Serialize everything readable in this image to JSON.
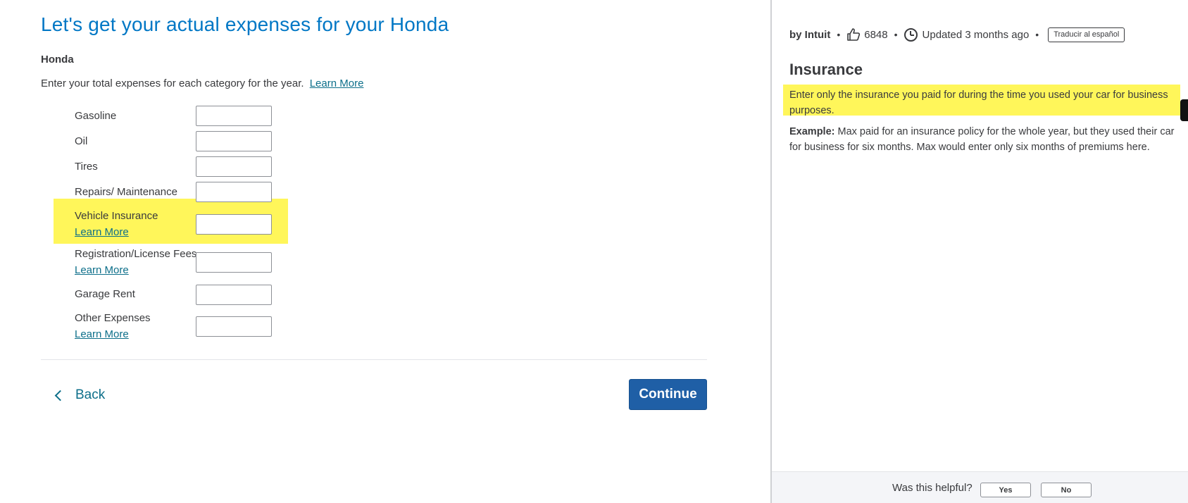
{
  "main": {
    "title": "Let's get your actual expenses for your Honda",
    "vehicle_name": "Honda",
    "intro_text": "Enter your total expenses for each category for the year.",
    "intro_link": "Learn More",
    "rows": [
      {
        "label": "Gasoline",
        "value": ""
      },
      {
        "label": "Oil",
        "value": ""
      },
      {
        "label": "Tires",
        "value": ""
      },
      {
        "label": "Repairs/ Maintenance",
        "value": ""
      },
      {
        "label": "Vehicle Insurance",
        "link": "Learn More",
        "value": ""
      },
      {
        "label": "Registration/License Fees",
        "link": "Learn More",
        "value": ""
      },
      {
        "label": "Garage Rent",
        "value": ""
      },
      {
        "label": "Other Expenses",
        "link": "Learn More",
        "value": ""
      }
    ],
    "back_label": "Back",
    "continue_label": "Continue"
  },
  "help": {
    "author": "by Intuit",
    "likes": "6848",
    "updated": "Updated 3 months ago",
    "translate_label": "Traducir al español",
    "title": "Insurance",
    "paragraph": "Enter only the insurance you paid for during the time you used your car for business purposes.",
    "example_label": "Example:",
    "example_text": "Max paid for an insurance policy for the whole year, but they used their car for business for six months. Max would enter only six months of premiums here.",
    "feedback_question": "Was this helpful?",
    "yes_label": "Yes",
    "no_label": "No"
  },
  "colors": {
    "title_blue": "#0077c5",
    "link_teal": "#0d6f8a",
    "continue_blue": "#1f5fa6",
    "highlight_yellow": "#fff65a"
  },
  "icons": {
    "likes": "thumbs-up-icon",
    "updated": "clock-icon",
    "back": "chevron-left-icon"
  }
}
